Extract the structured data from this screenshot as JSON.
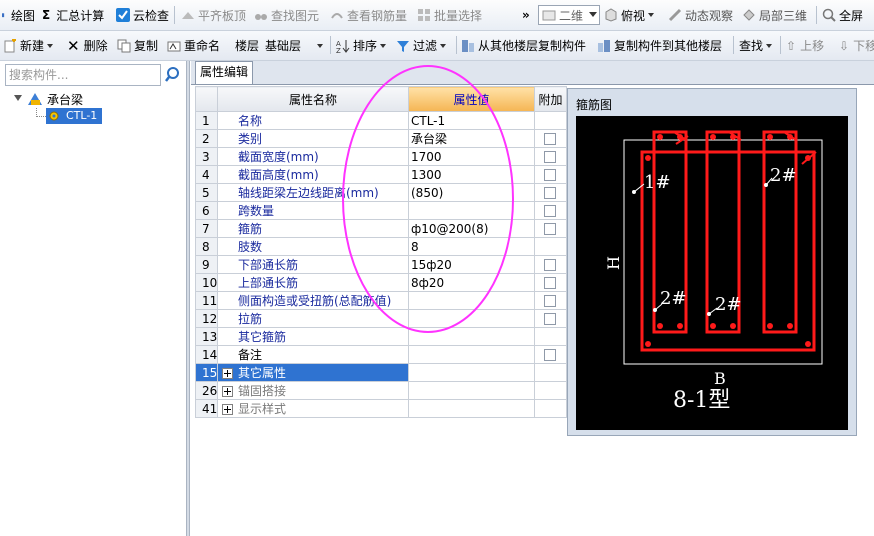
{
  "toolbar1": {
    "draw": "绘图",
    "sum": "汇总计算",
    "cloudcheck": "云检查",
    "flatboard": "平齐板顶",
    "findelem": "查找图元",
    "viewrebar": "查看钢筋量",
    "batchselect": "批量选择",
    "viewmode": "二维",
    "topview": "俯视",
    "dynamic": "动态观察",
    "local3d": "局部三维",
    "fullscreen": "全屏",
    "more": "»"
  },
  "toolbar2": {
    "new": "新建",
    "delete": "删除",
    "copy": "复制",
    "rename": "重命名",
    "floor_label": "楼层",
    "floor_value": "基础层",
    "sort": "排序",
    "filter": "过滤",
    "copy_from_floor": "从其他楼层复制构件",
    "copy_to_floor": "复制构件到其他楼层",
    "find": "查找",
    "move_up": "上移",
    "move_down": "下移"
  },
  "left": {
    "search_placeholder": "搜索构件...",
    "tree_root": "承台梁",
    "tree_child": "CTL-1"
  },
  "tab": {
    "label": "属性编辑"
  },
  "grid": {
    "headers": {
      "name": "属性名称",
      "value": "属性值",
      "extra": "附加"
    },
    "rows": [
      {
        "num": "1",
        "name": "名称",
        "value": "CTL-1",
        "check": false
      },
      {
        "num": "2",
        "name": "类别",
        "value": "承台梁",
        "check": true
      },
      {
        "num": "3",
        "name": "截面宽度(mm)",
        "value": "1700",
        "check": true
      },
      {
        "num": "4",
        "name": "截面高度(mm)",
        "value": "1300",
        "check": true
      },
      {
        "num": "5",
        "name": "轴线距梁左边线距离(mm)",
        "value": "(850)",
        "check": true
      },
      {
        "num": "6",
        "name": "跨数量",
        "value": "",
        "check": true
      },
      {
        "num": "7",
        "name": "箍筋",
        "value": "ф10@200(8)",
        "check": true
      },
      {
        "num": "8",
        "name": "肢数",
        "value": "8",
        "check": false
      },
      {
        "num": "9",
        "name": "下部通长筋",
        "value": "15ф20",
        "check": true
      },
      {
        "num": "10",
        "name": "上部通长筋",
        "value": "8ф20",
        "check": true
      },
      {
        "num": "11",
        "name": "侧面构造或受扭筋(总配筋值)",
        "value": "",
        "check": true
      },
      {
        "num": "12",
        "name": "拉筋",
        "value": "",
        "check": true
      },
      {
        "num": "13",
        "name": "其它箍筋",
        "value": "",
        "check": false
      },
      {
        "num": "14",
        "name": "备注",
        "value": "",
        "check": true
      }
    ],
    "groups": [
      {
        "num": "15",
        "name": "其它属性"
      },
      {
        "num": "26",
        "name": "锚固搭接"
      },
      {
        "num": "41",
        "name": "显示样式"
      }
    ]
  },
  "diagram": {
    "title": "箍筋图",
    "label_1": "1#",
    "label_2a": "2#",
    "label_2b": "2#",
    "label_2c": "2#",
    "h_label": "H",
    "b_label": "B",
    "type_label": "8-1型"
  },
  "colors": {
    "rebar": "#ff1a1a",
    "annotation": "#ff33ff",
    "selection": "#2f73d1",
    "header_highlight": "#f5b553"
  }
}
